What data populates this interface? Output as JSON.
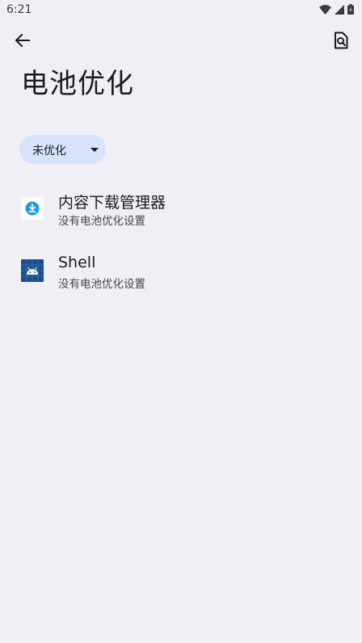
{
  "status_bar": {
    "time": "6:21",
    "icons": [
      "wifi-icon",
      "cell-signal-icon",
      "battery-icon"
    ]
  },
  "toolbar": {
    "back_icon": "arrow-left-icon",
    "search_icon": "search-document-icon"
  },
  "page": {
    "title": "电池优化"
  },
  "filter": {
    "selected": "未优化"
  },
  "apps": [
    {
      "name": "内容下载管理器",
      "subtitle": "没有电池优化设置",
      "icon": "download-manager-icon"
    },
    {
      "name": "Shell",
      "subtitle": "没有电池优化设置",
      "icon": "android-shell-icon"
    }
  ],
  "colors": {
    "background": "#f0eff5",
    "chip": "#d6e3fa",
    "download_accent": "#1a9be0",
    "shell_accent": "#1f4e8c"
  }
}
